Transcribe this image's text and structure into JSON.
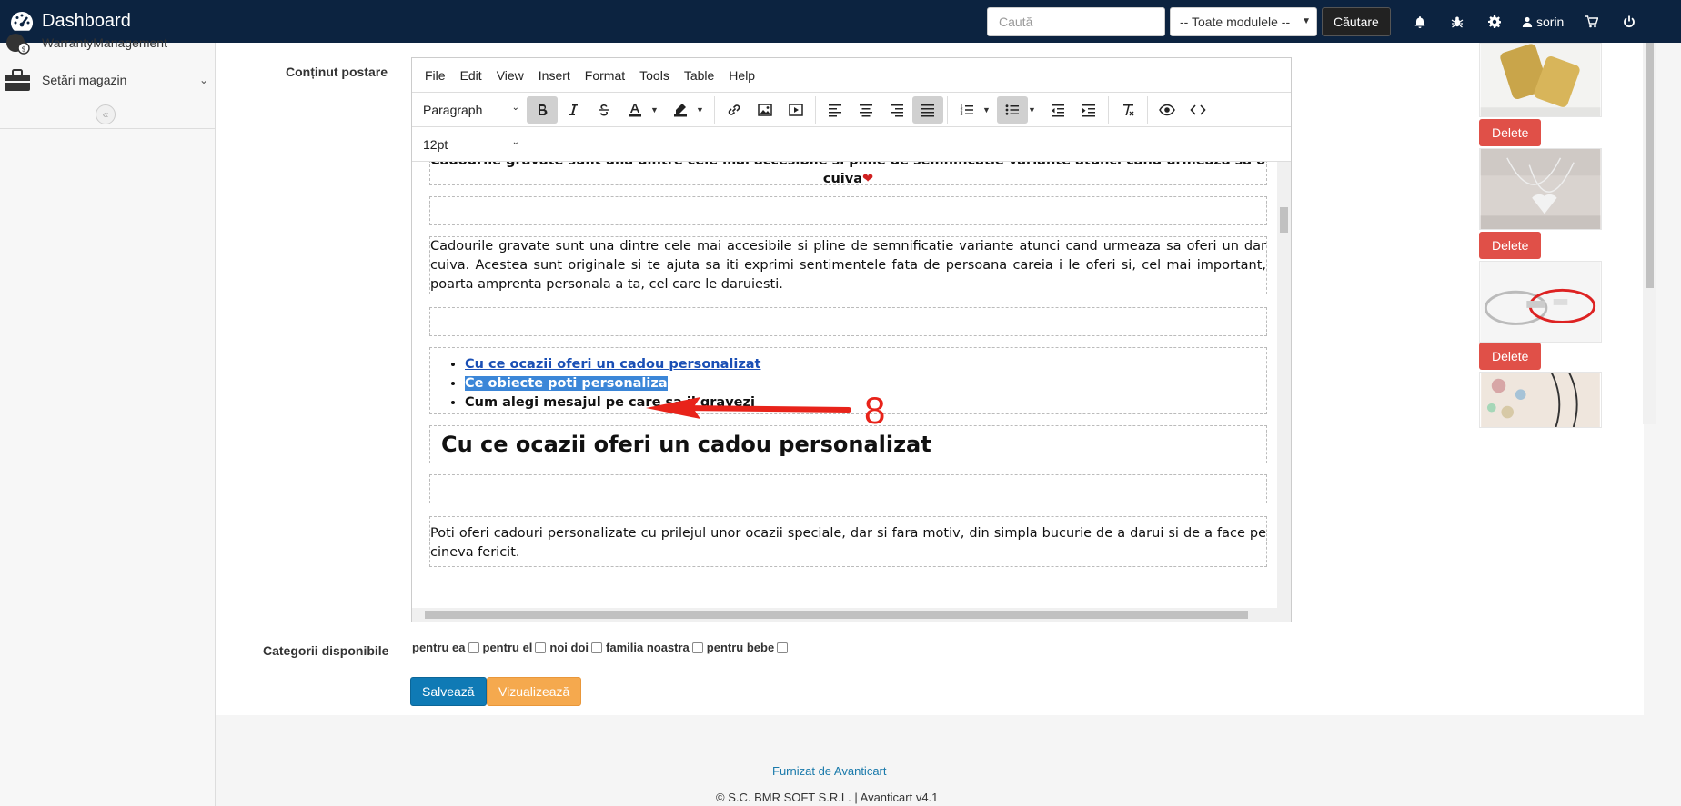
{
  "navbar": {
    "title": "Dashboard",
    "search_placeholder": "Caută",
    "module_select": "-- Toate modulele --",
    "search_button": "Căutare",
    "user_name": "sorin"
  },
  "sidebar": {
    "items": [
      {
        "label": "WarrantyManagement"
      },
      {
        "label": "Setări magazin"
      }
    ]
  },
  "form": {
    "content_label": "Conținut postare",
    "categories_label": "Categorii disponibile",
    "categories": [
      "pentru ea",
      "pentru el",
      "noi doi",
      "familia noastra",
      "pentru bebe"
    ],
    "save_button": "Salvează",
    "preview_button": "Vizualizează"
  },
  "editor": {
    "menu": [
      "File",
      "Edit",
      "View",
      "Insert",
      "Format",
      "Tools",
      "Table",
      "Help"
    ],
    "block_format": "Paragraph",
    "font_size": "12pt",
    "content": {
      "top_cut_text": "Cadourile gravate sunt una dintre cele mai accesibile si pline de semnificatie variante atunci cand urmeaza sa oferi un dar",
      "top_cut_text_end": "cuiva",
      "paragraph1": "Cadourile gravate sunt una dintre cele mai accesibile si pline de semnificatie variante atunci cand urmeaza sa oferi un dar cuiva. Acestea sunt originale si te ajuta sa iti exprimi sentimentele fata de persoana careia i le oferi si, cel mai important, poarta amprenta personala a ta, cel care le daruiesti.",
      "list_items": [
        "Cu ce ocazii oferi un cadou personalizat",
        "Ce obiecte poti personaliza",
        "Cum alegi mesajul pe care sa il gravezi"
      ],
      "heading": "Cu ce ocazii oferi un cadou personalizat",
      "paragraph2": "Poti oferi cadouri personalizate cu prilejul unor ocazii speciale, dar si fara motiv, din simpla bucurie de a darui si de a face pe cineva fericit."
    }
  },
  "annotation": {
    "number": "8"
  },
  "images": {
    "delete_label": "Delete"
  },
  "footer": {
    "link": "Furnizat de Avanticart",
    "copyright": "© S.C. BMR SOFT S.R.L. | Avanticart v4.1"
  },
  "colors": {
    "navbar": "#0c2340",
    "save": "#0f7ab5",
    "preview": "#f5a94e",
    "delete": "#e05048",
    "annotation": "#e8231a"
  }
}
